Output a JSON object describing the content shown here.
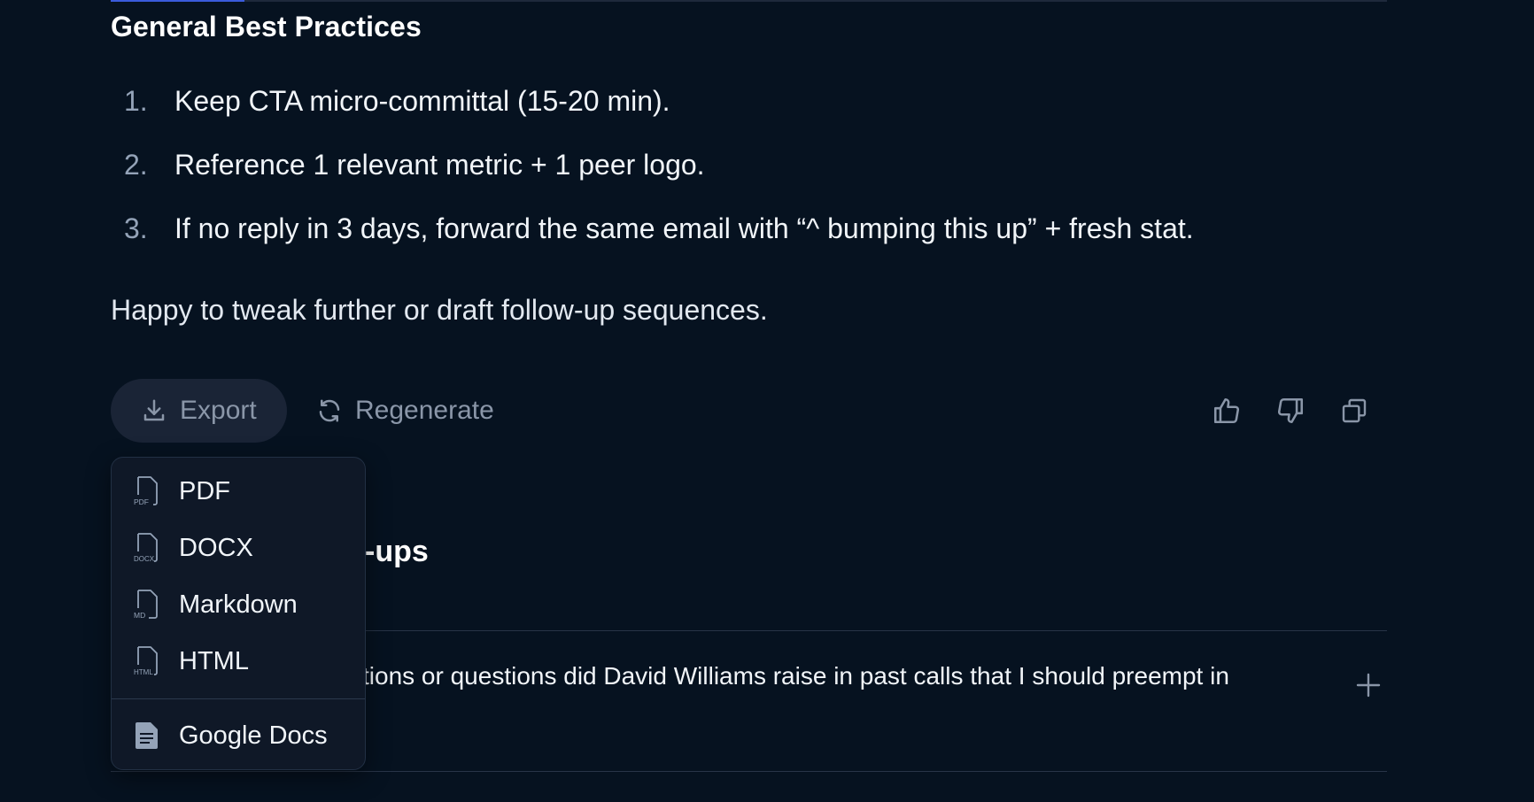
{
  "section": {
    "heading": "General Best Practices"
  },
  "practices": [
    {
      "number": "1.",
      "text": "Keep CTA micro-committal (15-20 min)."
    },
    {
      "number": "2.",
      "text": "Reference 1 relevant metric + 1 peer logo."
    },
    {
      "number": "3.",
      "text": "If no reply in 3 days, forward the same email with “^ bumping this up” + fresh stat."
    }
  ],
  "closing": "Happy to tweak further or draft follow-up sequences.",
  "actions": {
    "export_label": "Export",
    "regenerate_label": "Regenerate",
    "icons": [
      "thumbs-up-icon",
      "thumbs-down-icon",
      "copy-icon"
    ]
  },
  "export_menu": {
    "items": [
      {
        "label": "PDF",
        "icon_tag": "PDF"
      },
      {
        "label": "DOCX",
        "icon_tag": "DOCX"
      },
      {
        "label": "Markdown",
        "icon_tag": "MD"
      },
      {
        "label": "HTML",
        "icon_tag": "HTML"
      }
    ],
    "google_docs_label": "Google Docs"
  },
  "related": {
    "heading_visible_fragment": "-ups",
    "question_visible_fragment": "tions or questions did David Williams raise in past calls that I should preempt in"
  },
  "colors": {
    "background": "#061220",
    "accent": "#3b5bdb",
    "muted": "#8a96a8",
    "menu_background": "#0f1827"
  }
}
